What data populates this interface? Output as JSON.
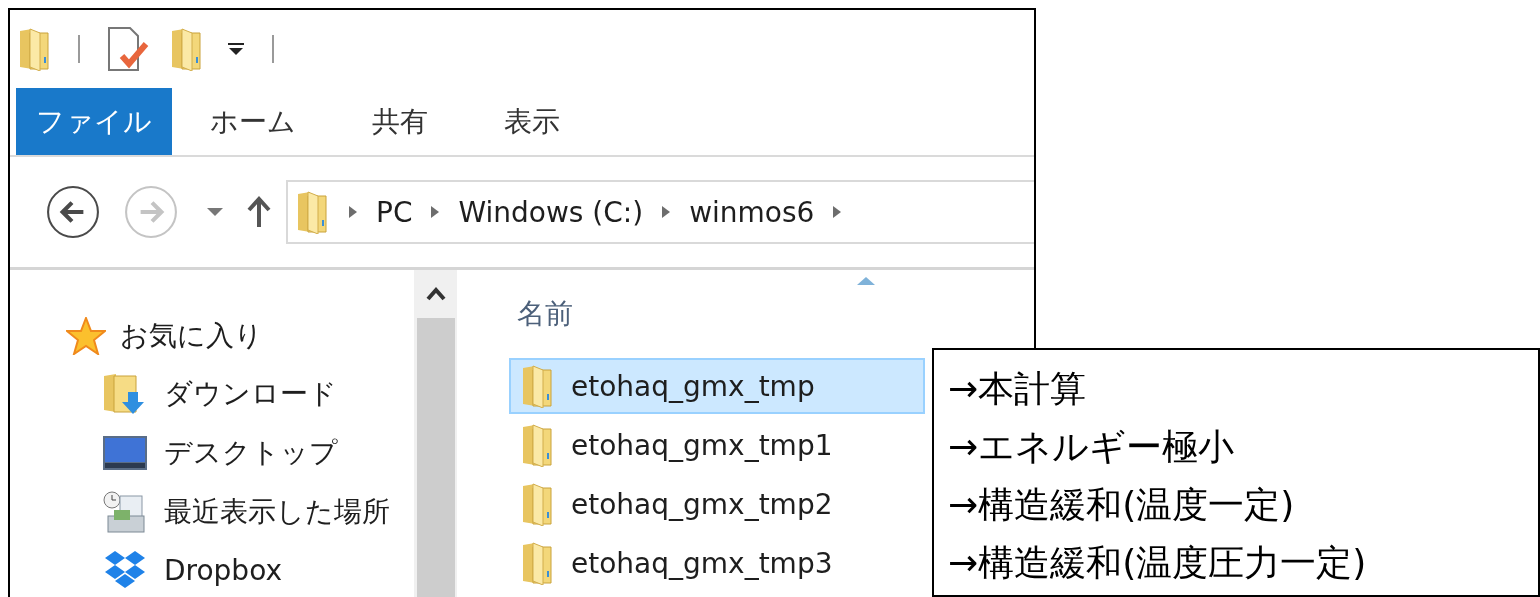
{
  "ribbon_tabs": [
    {
      "label": "ファイル",
      "kind": "file"
    },
    {
      "label": "ホーム",
      "kind": "tab"
    },
    {
      "label": "共有",
      "kind": "tab"
    },
    {
      "label": "表示",
      "kind": "tab"
    }
  ],
  "nav_buttons": [
    {
      "kind": "back",
      "disabled": false
    },
    {
      "kind": "forward",
      "disabled": true
    }
  ],
  "address_bar": {
    "path": [
      "PC",
      "Windows (C:)",
      "winmos6"
    ]
  },
  "navigation_pane": {
    "items": [
      {
        "label": "お気に入り",
        "kind": "favorites",
        "children": [
          {
            "label": "ダウンロード",
            "kind": "downloads"
          },
          {
            "label": "デスクトップ",
            "kind": "desktop"
          },
          {
            "label": "最近表示した場所",
            "kind": "recent"
          },
          {
            "label": "Dropbox",
            "kind": "dropbox"
          }
        ]
      }
    ]
  },
  "file_list": {
    "columns": [
      "名前"
    ],
    "rows": [
      {
        "name": "etohaq_gmx_tmp",
        "selected": true
      },
      {
        "name": "etohaq_gmx_tmp1",
        "selected": false
      },
      {
        "name": "etohaq_gmx_tmp2",
        "selected": false
      },
      {
        "name": "etohaq_gmx_tmp3",
        "selected": false
      }
    ]
  },
  "annotation": {
    "lines": [
      "→本計算",
      "→エネルギー極小",
      "→構造緩和(温度一定)",
      "→構造緩和(温度圧力一定)"
    ]
  }
}
